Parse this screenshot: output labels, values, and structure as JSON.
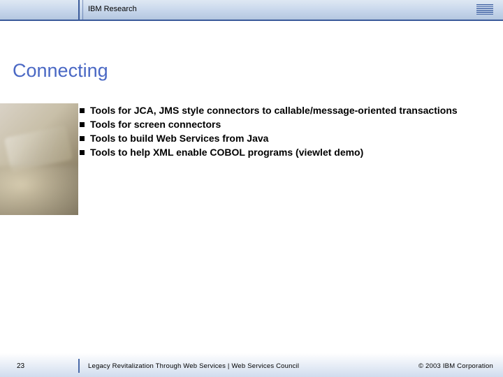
{
  "header": {
    "brand": "IBM Research"
  },
  "title": "Connecting",
  "bullets": [
    "Tools for JCA, JMS style connectors to callable/message-oriented transactions",
    "Tools for screen connectors",
    "Tools to build Web Services from Java",
    "Tools to help XML enable COBOL programs (viewlet demo)"
  ],
  "footer": {
    "page": "23",
    "text": "Legacy Revitalization Through Web Services  |  Web Services Council",
    "copyright": "© 2003 IBM Corporation"
  }
}
